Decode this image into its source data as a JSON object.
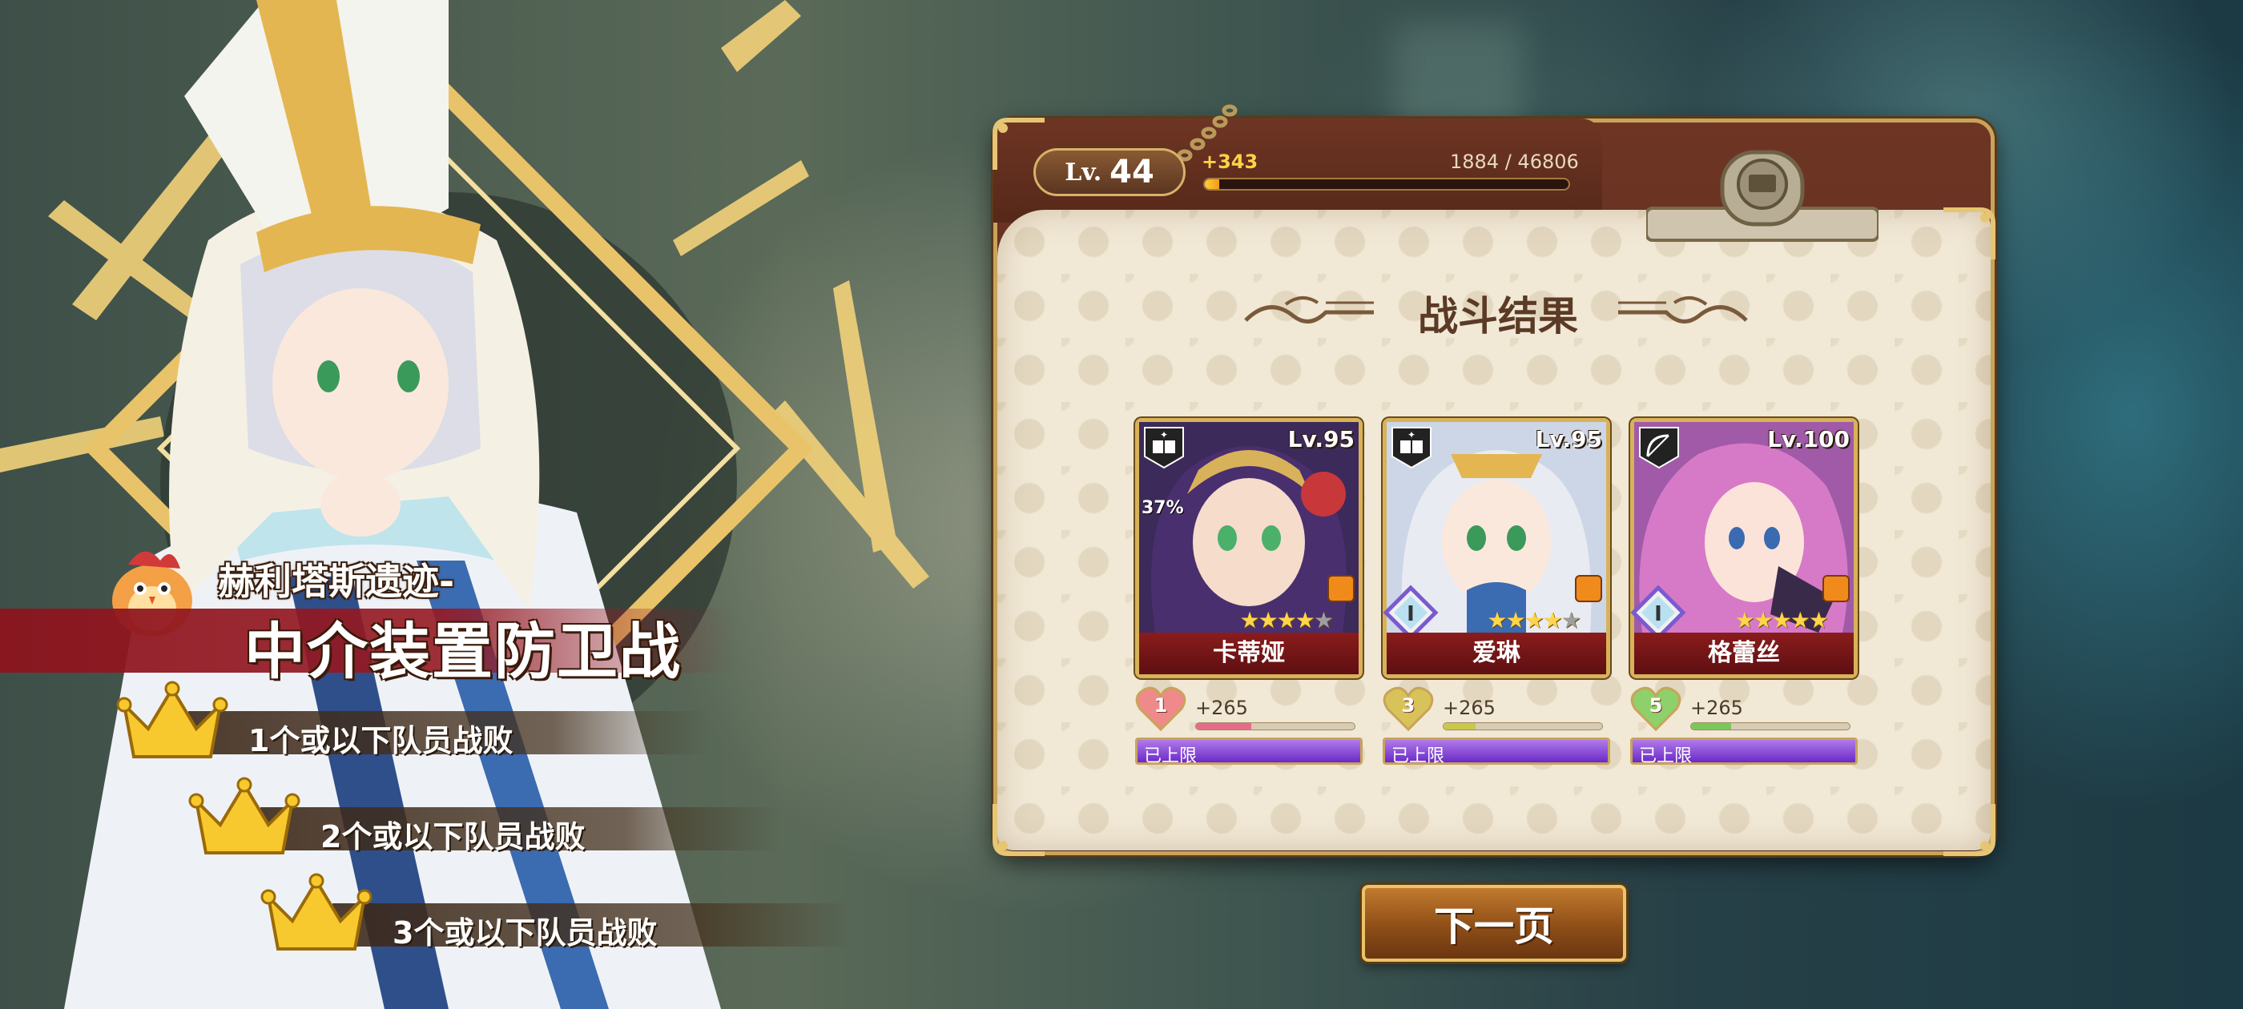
{
  "player": {
    "level_prefix": "Lv.",
    "level": "44",
    "exp_gain": "+343",
    "exp_progress": "1884 / 46806",
    "exp_fraction": 0.04
  },
  "stage": {
    "subtitle": "赫利塔斯遗迹-",
    "title": "中介装置防卫战",
    "conditions": [
      {
        "label": "1个或以下队员战败",
        "icon": "crown-icon"
      },
      {
        "label": "2个或以下队员战败",
        "icon": "crown-icon"
      },
      {
        "label": "3个或以下队员战败",
        "icon": "crown-icon"
      }
    ]
  },
  "result": {
    "title": "战斗结果",
    "units": [
      {
        "name": "卡蒂娅",
        "level": "Lv.95",
        "class_icon": "book-icon",
        "stars": 4,
        "max_stars": 5,
        "extra_badge": "37%",
        "affection_level": "1",
        "affection_gain": "+265",
        "affection_fraction": 0.35,
        "level_status": "已上限"
      },
      {
        "name": "爱琳",
        "level": "Lv.95",
        "class_icon": "book-icon",
        "rarity_icon": "diamond-rank-icon",
        "rarity_label": "I",
        "stars": 4,
        "max_stars": 5,
        "affection_level": "3",
        "affection_gain": "+265",
        "affection_fraction": 0.2,
        "level_status": "已上限"
      },
      {
        "name": "格蕾丝",
        "level": "Lv.100",
        "class_icon": "bow-icon",
        "rarity_icon": "diamond-rank-icon",
        "rarity_label": "I",
        "stars": 5,
        "max_stars": 5,
        "affection_level": "5",
        "affection_gain": "+265",
        "affection_fraction": 0.25,
        "level_status": "已上限"
      }
    ]
  },
  "buttons": {
    "next": "下一页"
  },
  "colors": {
    "panel_frame": "#6e3524",
    "panel_paper": "#f1e8d6",
    "gold": "#d8b25a",
    "card_name_bg": "#8a1c1c",
    "level_bar": "#6a2ac8",
    "stage_banner": "#8c141e"
  }
}
